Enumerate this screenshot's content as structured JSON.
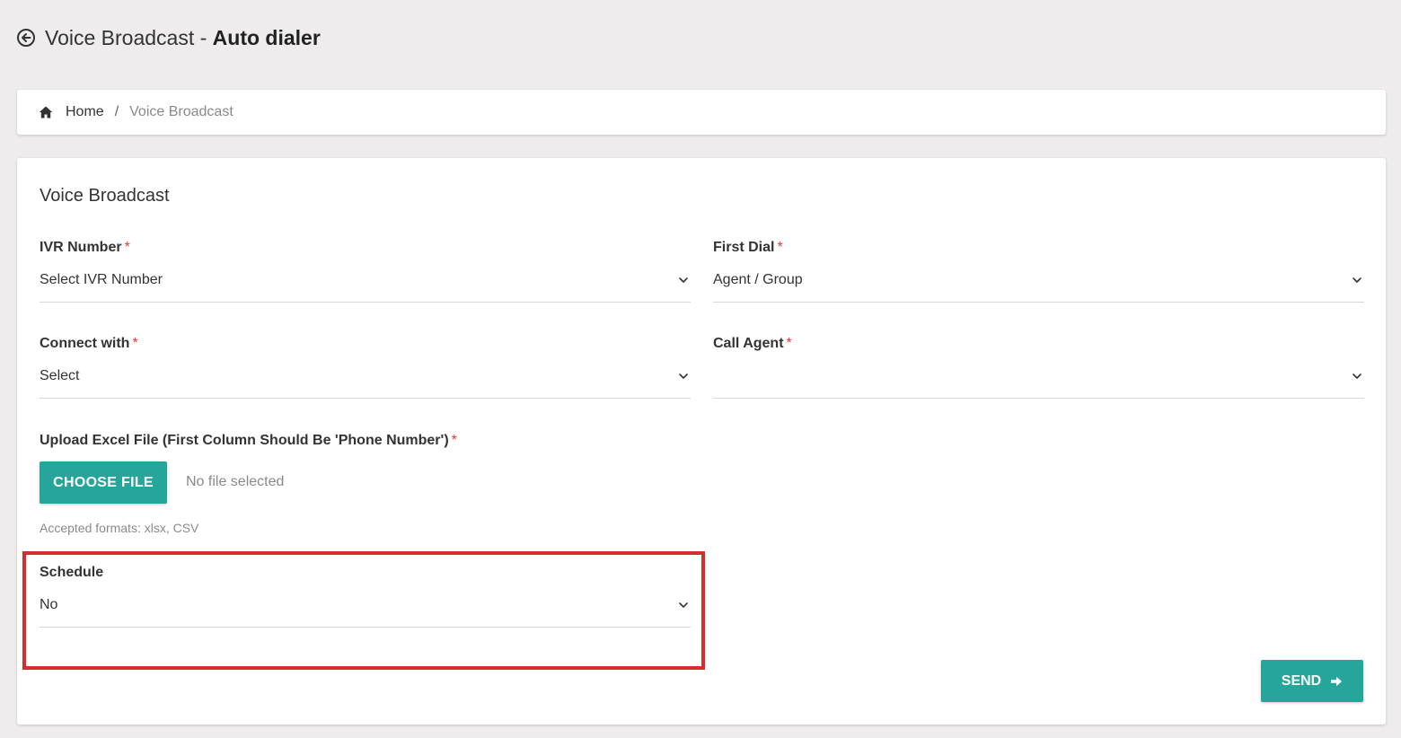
{
  "header": {
    "title_prefix": "Voice Broadcast - ",
    "title_strong": "Auto dialer",
    "back_icon": "arrow-circle-left-icon"
  },
  "breadcrumb": {
    "home_icon": "home-icon",
    "home_label": "Home",
    "separator": "/",
    "current_label": "Voice Broadcast"
  },
  "form": {
    "title": "Voice Broadcast",
    "required_mark": "*",
    "ivr_number": {
      "label": "IVR Number",
      "value": "Select IVR Number"
    },
    "first_dial": {
      "label": "First Dial",
      "value": "Agent / Group"
    },
    "connect_with": {
      "label": "Connect with",
      "value": "Select"
    },
    "call_agent": {
      "label": "Call Agent",
      "value": ""
    },
    "upload": {
      "label": "Upload Excel File (First Column Should Be 'Phone Number')",
      "button_label": "CHOOSE FILE",
      "status": "No file selected",
      "formats_hint": "Accepted formats: xlsx, CSV"
    },
    "schedule": {
      "label": "Schedule",
      "value": "No"
    },
    "send_label": "SEND",
    "send_icon": "arrow-right-icon"
  },
  "colors": {
    "accent": "#26a69a",
    "required": "#e53935",
    "highlight": "#d32f2f",
    "background": "#eeeced"
  }
}
